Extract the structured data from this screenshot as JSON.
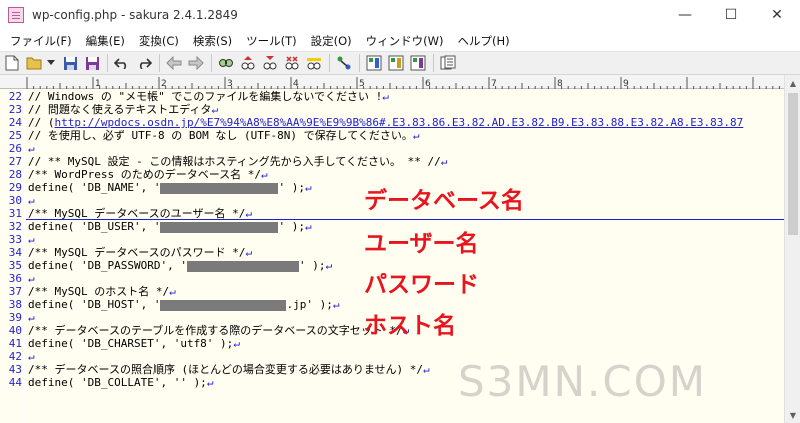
{
  "window": {
    "title": "wp-config.php - sakura 2.4.1.2849",
    "minimize_glyph": "—",
    "maximize_glyph": "☐",
    "close_glyph": "✕"
  },
  "menu": [
    "ファイル(F)",
    "編集(E)",
    "変換(C)",
    "検索(S)",
    "ツール(T)",
    "設定(O)",
    "ウィンドウ(W)",
    "ヘルプ(H)"
  ],
  "toolbar": {
    "icons": [
      "new-file-icon",
      "open-file-icon",
      "dropdown-arrow-icon",
      "save-icon",
      "save-all-icon",
      "undo-icon",
      "redo-icon",
      "jump-back-icon",
      "jump-forward-icon",
      "search-icon",
      "find-prev-icon",
      "find-next-icon",
      "replace-icon",
      "mark-icon",
      "grep-icon",
      "outline-icon",
      "settings-icon",
      "font-settings-icon",
      "type-settings-icon",
      "window-list-icon"
    ]
  },
  "ruler": {
    "labels": [
      "1",
      "2",
      "3",
      "4",
      "5",
      "6",
      "7",
      "8",
      "9"
    ]
  },
  "editor": {
    "lines": [
      {
        "num": "22",
        "pre": "// Windows の \"メモ帳\" でこのファイルを編集しないでください !",
        "nl": "↵"
      },
      {
        "num": "23",
        "pre": "// 問題なく使えるテキストエディタ",
        "nl": "↵"
      },
      {
        "num": "24",
        "pre": "// (",
        "url": "http://wpdocs.osdn.jp/%E7%94%A8%E8%AA%9E%E9%9B%86#.E3.83.86.E3.82.AD.E3.82.B9.E3.83.88.E3.82.A8.E3.83.87"
      },
      {
        "num": "25",
        "pre": "// を使用し、必ず UTF-8 の BOM なし (UTF-8N) で保存してください。",
        "nl": "↵"
      },
      {
        "num": "26",
        "pre": "",
        "nl": "↵"
      },
      {
        "num": "27",
        "pre": "// ** MySQL 設定 - この情報はホスティング先から入手してください。 ** //",
        "nl": "↵"
      },
      {
        "num": "28",
        "pre": "/** WordPress のためのデータベース名 */",
        "nl": "↵"
      },
      {
        "num": "29",
        "pre": "define( 'DB_NAME', '",
        "post": "' );",
        "nl": "↵"
      },
      {
        "num": "30",
        "pre": "",
        "nl": "↵"
      },
      {
        "num": "31",
        "pre": "/** MySQL データベースのユーザー名 */",
        "nl": "↵"
      },
      {
        "num": "32",
        "pre": "define( 'DB_USER', '",
        "post": "' );",
        "nl": "↵"
      },
      {
        "num": "33",
        "pre": "",
        "nl": "↵"
      },
      {
        "num": "34",
        "pre": "/** MySQL データベースのパスワード */",
        "nl": "↵"
      },
      {
        "num": "35",
        "pre": "define( 'DB_PASSWORD', '",
        "post": "' );",
        "nl": "↵"
      },
      {
        "num": "36",
        "pre": "",
        "nl": "↵"
      },
      {
        "num": "37",
        "pre": "/** MySQL のホスト名 */",
        "nl": "↵"
      },
      {
        "num": "38",
        "pre": "define( 'DB_HOST', '",
        "post": ".jp' );",
        "nl": "↵"
      },
      {
        "num": "39",
        "pre": "",
        "nl": "↵"
      },
      {
        "num": "40",
        "pre": "/** データベースのテーブルを作成する際のデータベースの文字セット */",
        "nl": "↵"
      },
      {
        "num": "41",
        "pre": "define( 'DB_CHARSET', 'utf8' );",
        "nl": "↵"
      },
      {
        "num": "42",
        "pre": "",
        "nl": "↵"
      },
      {
        "num": "43",
        "pre": "/** データベースの照合順序 (ほとんどの場合変更する必要はありません) */",
        "nl": "↵"
      },
      {
        "num": "44",
        "pre": "define( 'DB_COLLATE', '' );",
        "nl": "↵"
      }
    ]
  },
  "annotations": {
    "db_name": "データベース名",
    "db_user": "ユーザー名",
    "db_password": "パスワード",
    "db_host": "ホスト名"
  },
  "watermark": "S3MN.COM",
  "colors": {
    "line_number": "#1f1fd4",
    "annotation": "#e8141e",
    "editor_bg": "#fffef0"
  }
}
